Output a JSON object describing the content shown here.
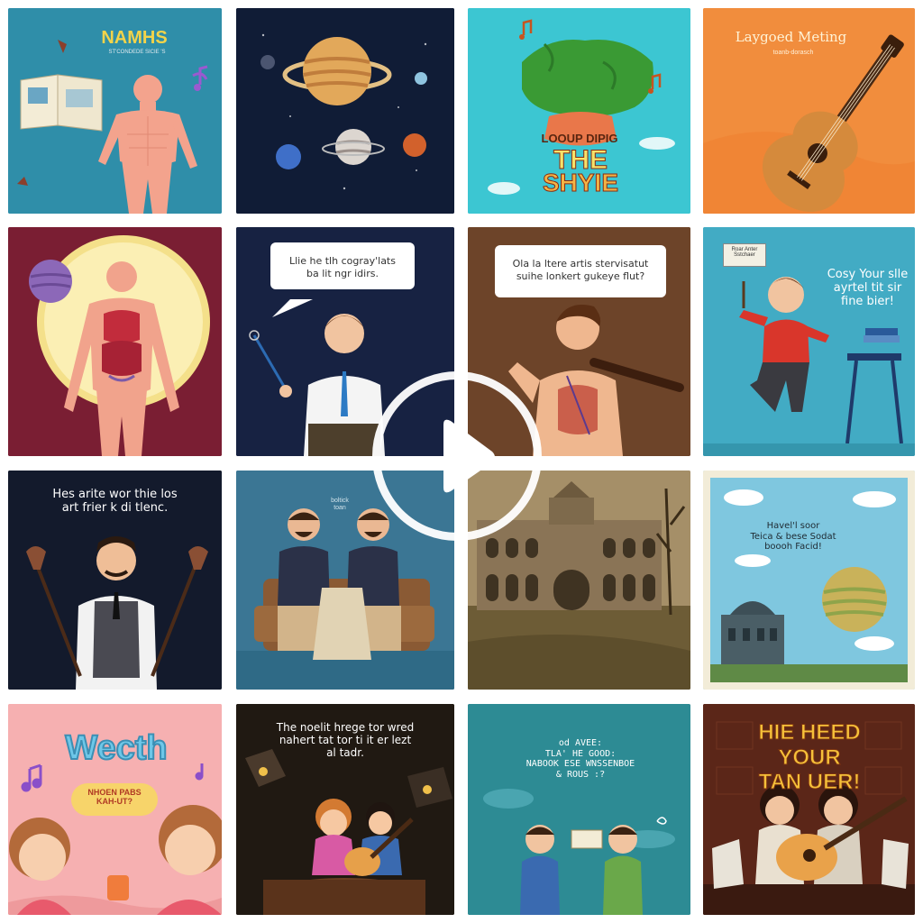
{
  "tiles": [
    {
      "title": "NAMHS",
      "subtitle": "ST'CONDEDE SICIE 'S"
    },
    {
      "title": ""
    },
    {
      "line1": "LOOUP DIPIG",
      "line2": "THE",
      "line3": "SHYIE"
    },
    {
      "title": "Laygoed Meting",
      "subtitle": "toanb-dorasch"
    },
    {
      "title": ""
    },
    {
      "bubble": "Llie he tlh cogray'lats\nba lit ngr idirs."
    },
    {
      "bubble": "Ola la ltere artis stervisatut\nsuihe lonkert gukeye flut?"
    },
    {
      "sign": "Roar Anter\nSstchaer",
      "text": "Cosy Your slle\nayrtel tit sir\nfine bier!"
    },
    {
      "text": "Hes arite wor thie los\nart frier k di tlenc."
    },
    {
      "small": "boltick\ntoan"
    },
    {
      "title": ""
    },
    {
      "text": "Havel'l soor\nTeica & bese Sodat\nboooh Facid!"
    },
    {
      "title": "Wecth",
      "badge": "NHOEN PABS\nKAH-UT?"
    },
    {
      "text": "The noelit hrege tor wred\nnahert tat tor ti it er lezt\nal tadr."
    },
    {
      "text": "od AVEE:\nTLA' HE GOOD:\nNABOOK ESE WNSSENBOE\n& ROUS :?"
    },
    {
      "title": "HIE HEED YOUR\nTAN UER!"
    }
  ],
  "overlay": {
    "icon": "play-icon"
  }
}
